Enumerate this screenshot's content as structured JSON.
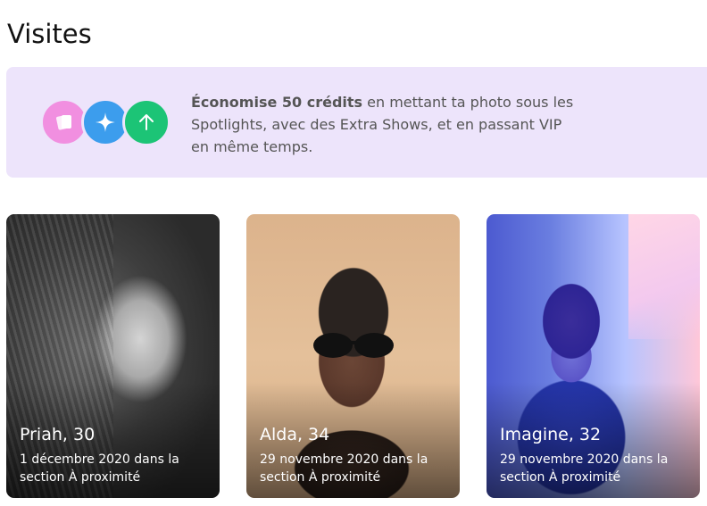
{
  "page": {
    "title": "Visites"
  },
  "promo": {
    "icons": [
      "cards-icon",
      "sparkle-icon",
      "arrow-up-icon"
    ],
    "colors": {
      "background": "#ede4fb",
      "pink": "#f18fe0",
      "blue": "#3c9ded",
      "green": "#1cc476"
    },
    "text_bold": "Économise 50 crédits",
    "text_rest": " en mettant ta photo sous les Spotlights, avec des Extra Shows, et en passant VIP en même temps."
  },
  "visitors": [
    {
      "name_age": "Priah, 30",
      "date": "1 décembre 2020 dans la",
      "section": "section À proximité"
    },
    {
      "name_age": "Alda, 34",
      "date": "29 novembre 2020 dans la",
      "section": "section À proximité"
    },
    {
      "name_age": "Imagine, 32",
      "date": "29 novembre 2020 dans la",
      "section": "section À proximité"
    }
  ]
}
